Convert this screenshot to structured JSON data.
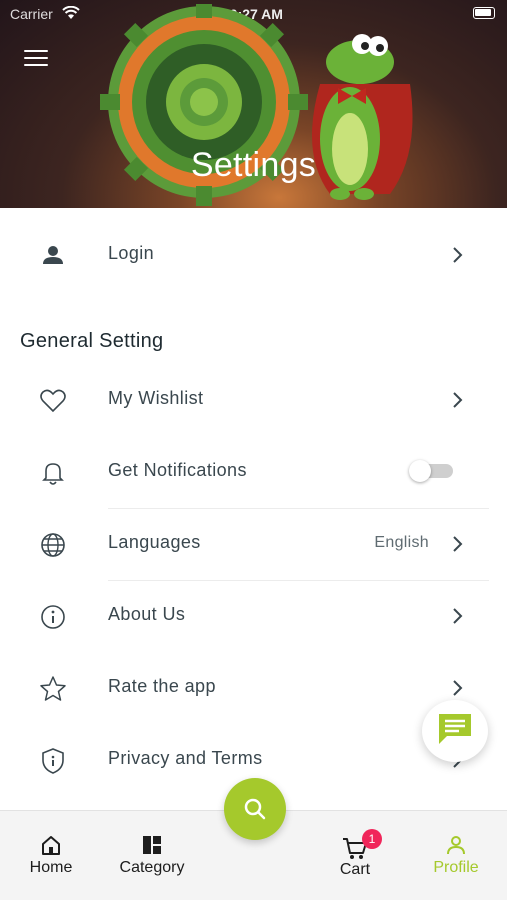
{
  "status_bar": {
    "carrier": "Carrier",
    "time": "10:27 AM"
  },
  "header": {
    "title": "Settings"
  },
  "login": {
    "label": "Login"
  },
  "general": {
    "title": "General Setting",
    "items": [
      {
        "label": "My Wishlist",
        "icon": "heart-icon"
      },
      {
        "label": "Get Notifications",
        "icon": "bell-icon",
        "toggle": false
      },
      {
        "label": "Languages",
        "icon": "globe-icon",
        "value": "English"
      },
      {
        "label": "About Us",
        "icon": "info-icon"
      },
      {
        "label": "Rate the app",
        "icon": "star-icon"
      },
      {
        "label": "Privacy and Terms",
        "icon": "shield-icon"
      }
    ]
  },
  "tabs": [
    {
      "label": "Home",
      "icon": "home-icon"
    },
    {
      "label": "Category",
      "icon": "category-icon"
    },
    {
      "label": "Cart",
      "icon": "cart-icon",
      "badge": "1"
    },
    {
      "label": "Profile",
      "icon": "profile-icon",
      "active": true
    }
  ],
  "colors": {
    "accent": "#a5c92c",
    "badge": "#f0265a",
    "text": "#3a474e"
  }
}
